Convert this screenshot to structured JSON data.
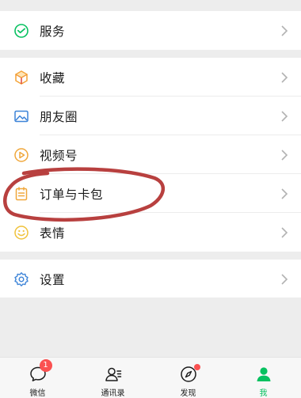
{
  "menu": {
    "services": {
      "label": "服务",
      "icon": "services-icon"
    },
    "favorites": {
      "label": "收藏",
      "icon": "favorites-cube-icon"
    },
    "moments": {
      "label": "朋友圈",
      "icon": "moments-picture-icon"
    },
    "channels": {
      "label": "视频号",
      "icon": "channels-play-icon"
    },
    "orders_cards": {
      "label": "订单与卡包",
      "icon": "orders-cards-icon"
    },
    "stickers": {
      "label": "表情",
      "icon": "stickers-smile-icon"
    },
    "settings": {
      "label": "设置",
      "icon": "settings-gear-icon"
    }
  },
  "tabbar": {
    "tabs": [
      {
        "label": "微信",
        "badge": "1",
        "icon": "chat-bubble-icon"
      },
      {
        "label": "通讯录",
        "icon": "contacts-icon"
      },
      {
        "label": "发现",
        "icon": "discover-compass-icon"
      },
      {
        "label": "我",
        "icon": "me-person-icon",
        "active": true
      }
    ]
  },
  "colors": {
    "active": "#07c160",
    "badge": "#fa5151",
    "annotation": "#b8403f"
  }
}
